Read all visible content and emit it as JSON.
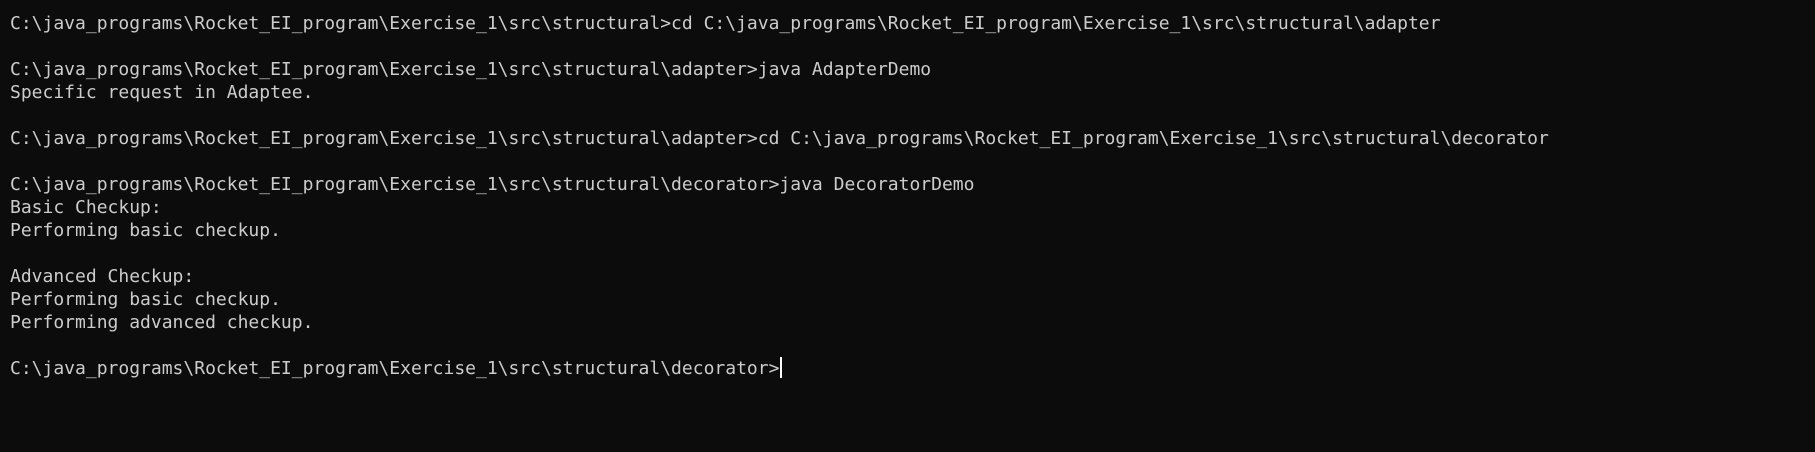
{
  "theme": {
    "background": "#0c0c0c",
    "foreground": "#cccccc",
    "cursor": "#ffffff"
  },
  "terminal": {
    "lines": [
      "C:\\java_programs\\Rocket_EI_program\\Exercise_1\\src\\structural>cd C:\\java_programs\\Rocket_EI_program\\Exercise_1\\src\\structural\\adapter",
      "",
      "C:\\java_programs\\Rocket_EI_program\\Exercise_1\\src\\structural\\adapter>java AdapterDemo",
      "Specific request in Adaptee.",
      "",
      "C:\\java_programs\\Rocket_EI_program\\Exercise_1\\src\\structural\\adapter>cd C:\\java_programs\\Rocket_EI_program\\Exercise_1\\src\\structural\\decorator",
      "",
      "C:\\java_programs\\Rocket_EI_program\\Exercise_1\\src\\structural\\decorator>java DecoratorDemo",
      "Basic Checkup:",
      "Performing basic checkup.",
      "",
      "Advanced Checkup:",
      "Performing basic checkup.",
      "Performing advanced checkup.",
      "",
      "C:\\java_programs\\Rocket_EI_program\\Exercise_1\\src\\structural\\decorator>"
    ]
  }
}
